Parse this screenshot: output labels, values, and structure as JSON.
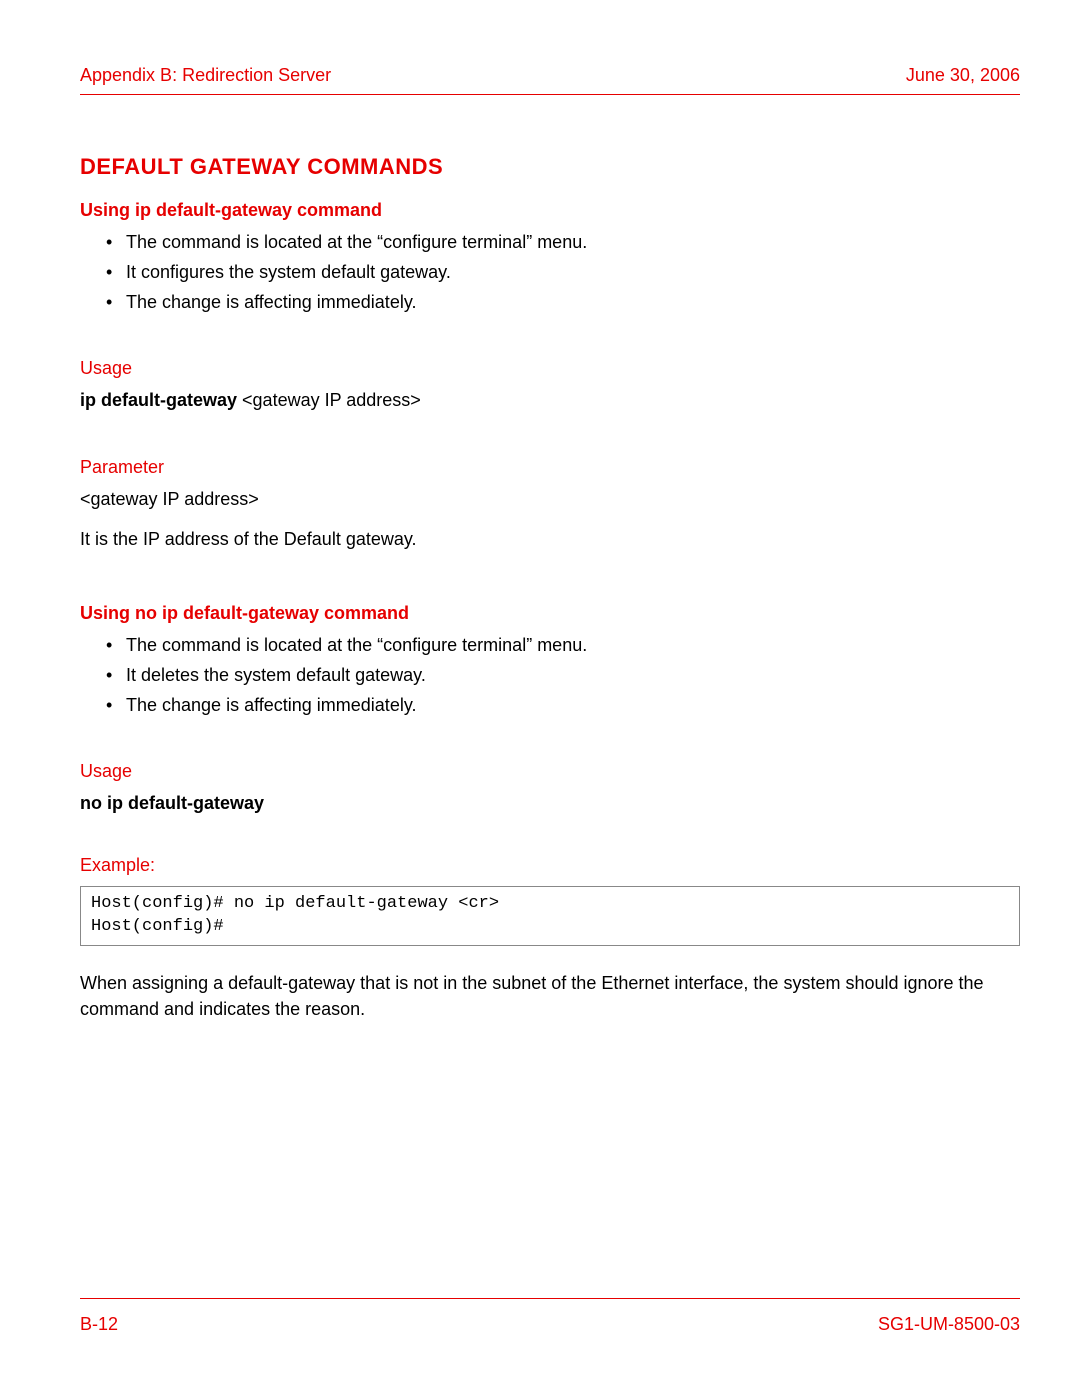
{
  "header": {
    "left": "Appendix B: Redirection Server",
    "right": "June 30, 2006"
  },
  "section_title": "Default Gateway Commands",
  "block1": {
    "heading": "Using ip default-gateway command",
    "bullets": [
      "The command is located at the “configure terminal” menu.",
      "It configures the system default gateway.",
      "The change is affecting immediately."
    ],
    "usage_label": "Usage",
    "usage_cmd_bold": "ip default-gateway",
    "usage_cmd_rest": " <gateway IP address>",
    "parameter_label": "Parameter",
    "parameter_syntax": "<gateway IP address>",
    "parameter_desc": "It is the IP address of the Default gateway."
  },
  "block2": {
    "heading": "Using no ip default-gateway command",
    "bullets": [
      "The command is located at the “configure terminal” menu.",
      "It deletes the system default gateway.",
      "The change is affecting immediately."
    ],
    "usage_label": "Usage",
    "usage_cmd_bold": "no ip default-gateway",
    "example_label": "Example:",
    "example_code": "Host(config)# no ip default-gateway <cr>\nHost(config)#",
    "trailing_para": "When assigning a default-gateway that is not in the subnet of the Ethernet interface, the system should ignore the command and indicates the reason."
  },
  "footer": {
    "left": "B-12",
    "right": "SG1-UM-8500-03"
  }
}
